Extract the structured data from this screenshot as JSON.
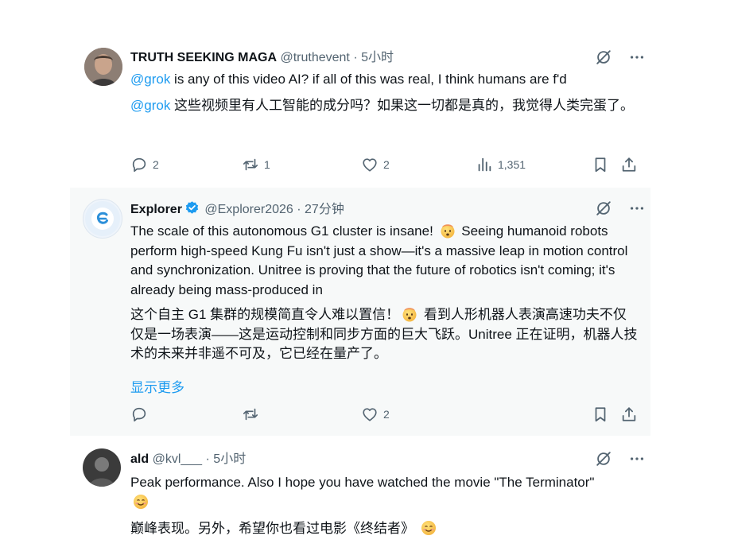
{
  "posts": [
    {
      "name": "TRUTH SEEKING MAGA",
      "handle": "@truthevent",
      "time": "· 5小时",
      "mention": "@grok",
      "text_en": " is any of this video AI? if all of this was real, I think humans are f'd",
      "mention_zh": "@grok",
      "text_zh": " 这些视频里有人工智能的成分吗？如果这一切都是真的，我觉得人类完蛋了。",
      "replies": "2",
      "reposts": "1",
      "likes": "2",
      "views": "1,351"
    },
    {
      "name": "Explorer",
      "handle": "@Explorer2026",
      "time": "· 27分钟",
      "text_en_1": "The scale of this autonomous G1 cluster is insane! ",
      "text_en_2": " Seeing humanoid robots perform high-speed Kung Fu isn't just a show—it's a massive leap in motion control and synchronization. Unitree is proving that the future of robotics isn't coming; it's already being mass-produced in",
      "text_zh_1": "这个自主 G1 集群的规模简直令人难以置信！",
      "text_zh_2": " 看到人形机器人表演高速功夫不仅仅是一场表演——这是运动控制和同步方面的巨大飞跃。Unitree 正在证明，机器人技术的未来并非遥不可及，它已经在量产了。",
      "show_more": "显示更多",
      "likes": "2",
      "verified_color": "#1d9bf0"
    },
    {
      "name": "ald",
      "handle": "@kvl___",
      "time": "· 5小时",
      "text_en": "Peak performance. Also I hope you have watched the movie \"The Terminator\"",
      "text_zh": "巅峰表现。另外，希望你也看过电影《终结者》"
    }
  ],
  "icons": {
    "grok": "grok-icon",
    "more": "more-icon",
    "reply": "reply-icon",
    "repost": "repost-icon",
    "like": "like-icon",
    "views": "views-icon",
    "bookmark": "bookmark-icon",
    "share": "share-icon",
    "emoji_shocked": "exploding-head-emoji",
    "emoji_smile": "smiling-emoji"
  },
  "colors": {
    "accent": "#1d9bf0",
    "text": "#0f1419",
    "muted": "#536471"
  }
}
